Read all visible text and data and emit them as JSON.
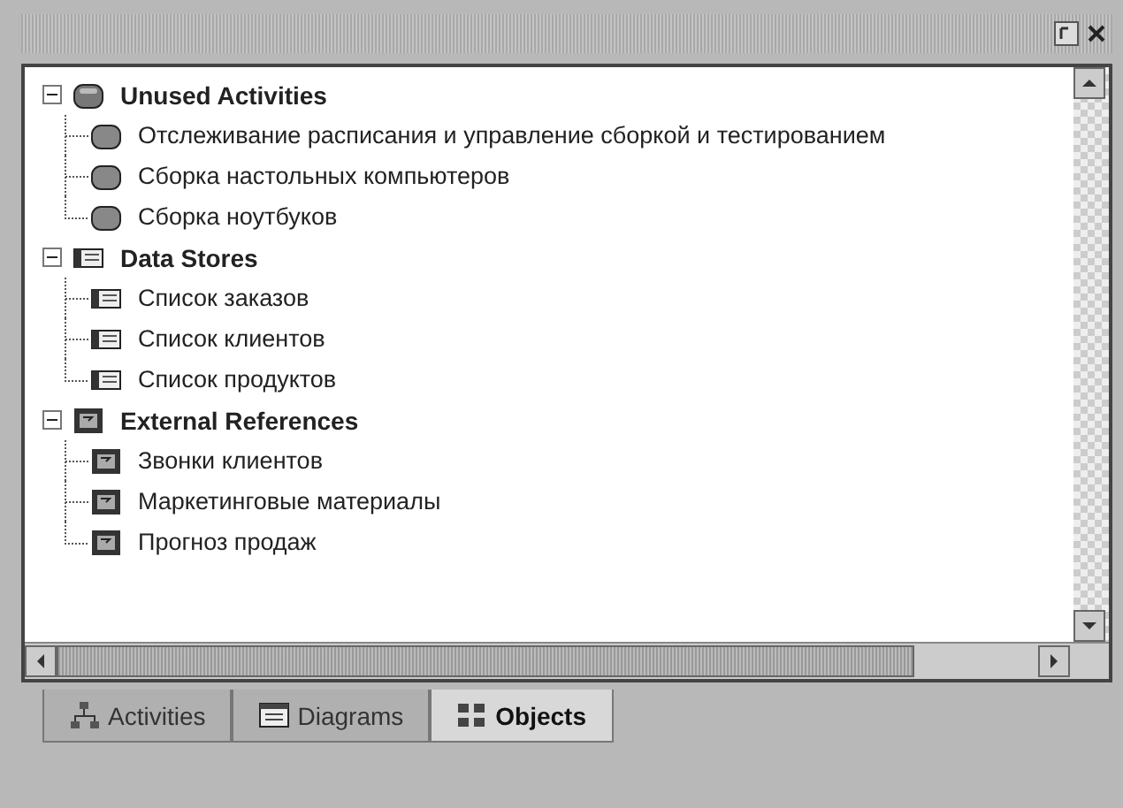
{
  "groups": [
    {
      "label": "Unused Activities",
      "kind": "activity",
      "expanded": true,
      "children": [
        {
          "label": "Отслеживание расписания и управление сборкой и тестированием"
        },
        {
          "label": "Сборка настольных компьютеров"
        },
        {
          "label": "Сборка ноутбуков"
        }
      ]
    },
    {
      "label": "Data Stores",
      "kind": "store",
      "expanded": true,
      "children": [
        {
          "label": "Список заказов"
        },
        {
          "label": "Список клиентов"
        },
        {
          "label": "Список продуктов"
        }
      ]
    },
    {
      "label": "External References",
      "kind": "reference",
      "expanded": true,
      "children": [
        {
          "label": "Звонки клиентов"
        },
        {
          "label": "Маркетинговые материалы"
        },
        {
          "label": "Прогноз продаж"
        }
      ]
    }
  ],
  "tabs": [
    {
      "label": "Activities",
      "kind": "activities",
      "selected": false
    },
    {
      "label": "Diagrams",
      "kind": "diagrams",
      "selected": false
    },
    {
      "label": "Objects",
      "kind": "objects",
      "selected": true
    }
  ]
}
